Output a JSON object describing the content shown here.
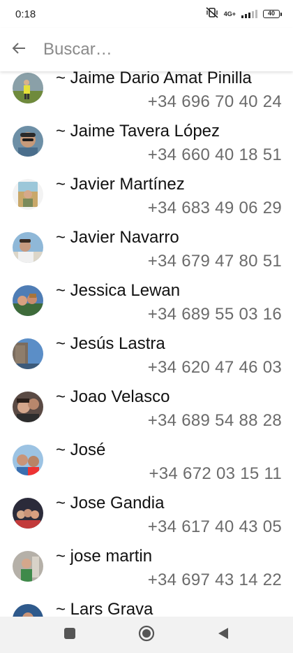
{
  "status": {
    "time": "0:18",
    "network": "4G+",
    "battery": "40"
  },
  "header": {
    "back_icon": "arrow-left-icon",
    "search_placeholder": "Buscar…"
  },
  "contacts": [
    {
      "name": "~ Jaime Dario Amat Pinilla",
      "phone": "+34 696 70 40 24",
      "avatar_color": "#6f8a3c"
    },
    {
      "name": "~ Jaime Tavera López",
      "phone": "+34 660 40 18 51",
      "avatar_color": "#4a6e8c"
    },
    {
      "name": "~ Javier Martínez",
      "phone": "+34 683 49 06 29",
      "avatar_color": "#c9a86a"
    },
    {
      "name": "~ Javier Navarro",
      "phone": "+34 679 47 80 51",
      "avatar_color": "#8fb8d8"
    },
    {
      "name": "~ Jessica Lewan",
      "phone": "+34 689 55 03 16",
      "avatar_color": "#4f7db5"
    },
    {
      "name": "~ Jesús Lastra",
      "phone": "+34 620 47 46 03",
      "avatar_color": "#5b8ec7"
    },
    {
      "name": "~ Joao Velasco",
      "phone": "+34 689 54 88 28",
      "avatar_color": "#5a4a44"
    },
    {
      "name": "~ José",
      "phone": "+34 672 03 15 11",
      "avatar_color": "#3a6fb0"
    },
    {
      "name": "~ Jose Gandia",
      "phone": "+34 617 40 43 05",
      "avatar_color": "#2b2b3a"
    },
    {
      "name": "~ jose martin",
      "phone": "+34 697 43 14 22",
      "avatar_color": "#b5b0a8"
    },
    {
      "name": "~ Lars Grava",
      "phone": "",
      "avatar_color": "#2f5a8c"
    }
  ],
  "navigation": {
    "recents_icon": "square-icon",
    "home_icon": "circle-home-icon",
    "back_icon": "triangle-back-icon"
  }
}
